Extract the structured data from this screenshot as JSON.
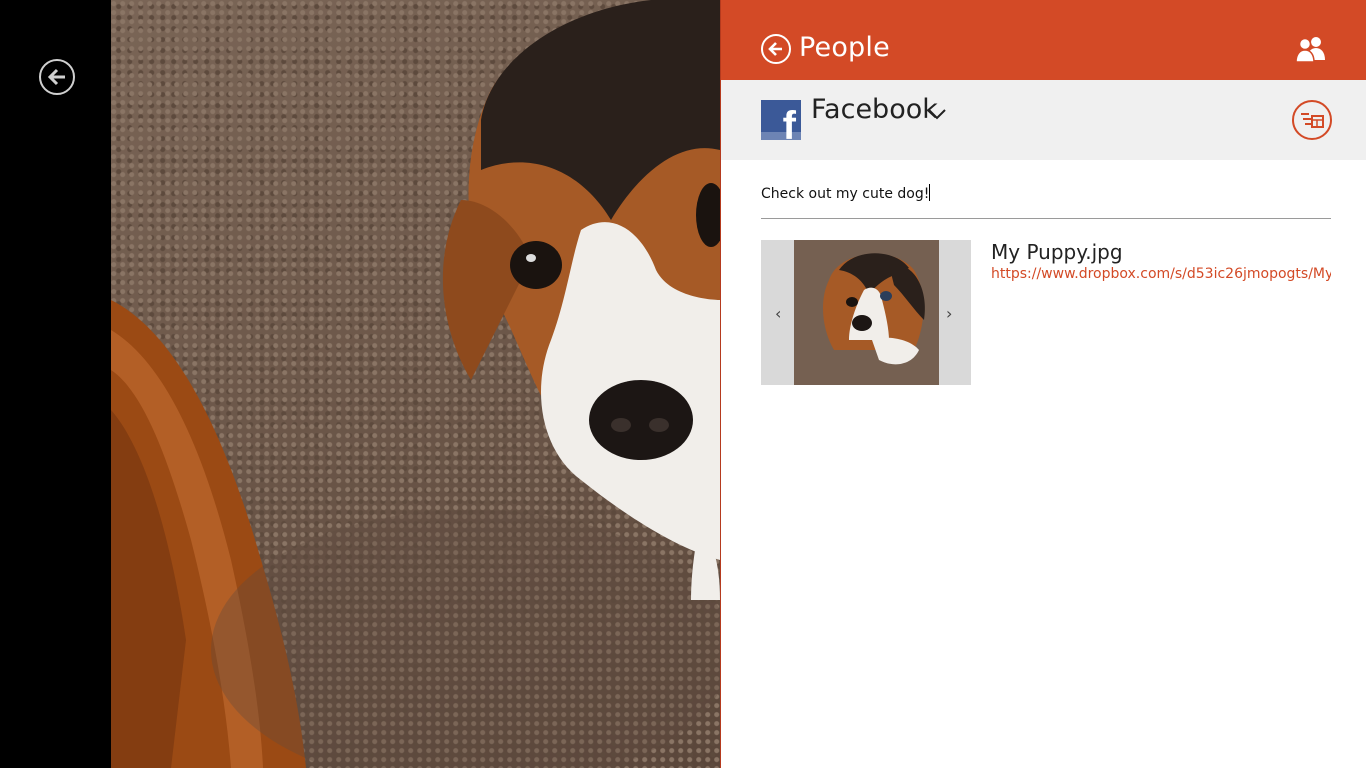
{
  "header": {
    "title": "People"
  },
  "account": {
    "name": "Facebook"
  },
  "message": {
    "text": "Check out my cute dog!"
  },
  "attachment": {
    "file_name": "My Puppy.jpg",
    "link": "https://www.dropbox.com/s/d53ic26jmopogts/My...",
    "prev_label": "‹",
    "next_label": "›"
  },
  "colors": {
    "accent": "#d34a26",
    "account_bar": "#f0f0f0",
    "facebook_blue": "#3b5998"
  },
  "icons": {
    "left_back": "back-arrow-icon",
    "header_back": "back-arrow-icon",
    "people": "people-icon",
    "sharing_options": "share-list-icon",
    "account_chevron": "chevron-down-icon"
  }
}
